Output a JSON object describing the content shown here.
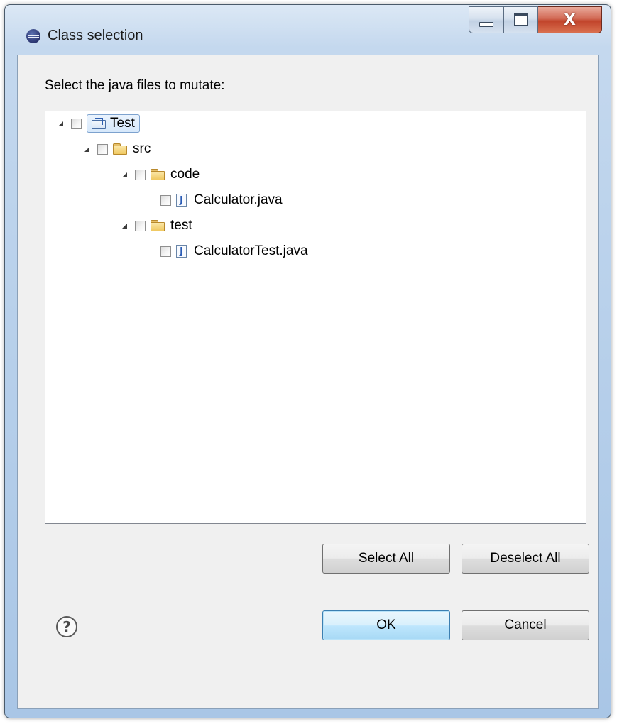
{
  "window": {
    "title": "Class selection",
    "close_glyph": "X"
  },
  "prompt": "Select the java files to mutate:",
  "tree": [
    {
      "label": "Test",
      "type": "project",
      "level": 0,
      "expanded": true,
      "checked": false,
      "selected": true
    },
    {
      "label": "src",
      "type": "folder",
      "level": 1,
      "expanded": true,
      "checked": false
    },
    {
      "label": "code",
      "type": "folder",
      "level": 2,
      "expanded": true,
      "checked": false
    },
    {
      "label": "Calculator.java",
      "type": "java-file",
      "level": 3,
      "checked": false
    },
    {
      "label": "test",
      "type": "folder",
      "level": 2,
      "expanded": true,
      "checked": false
    },
    {
      "label": "CalculatorTest.java",
      "type": "java-file",
      "level": 3,
      "checked": false
    }
  ],
  "buttons": {
    "select_all": "Select All",
    "deselect_all": "Deselect All",
    "ok": "OK",
    "cancel": "Cancel"
  },
  "help_glyph": "?",
  "java_glyph": "J"
}
